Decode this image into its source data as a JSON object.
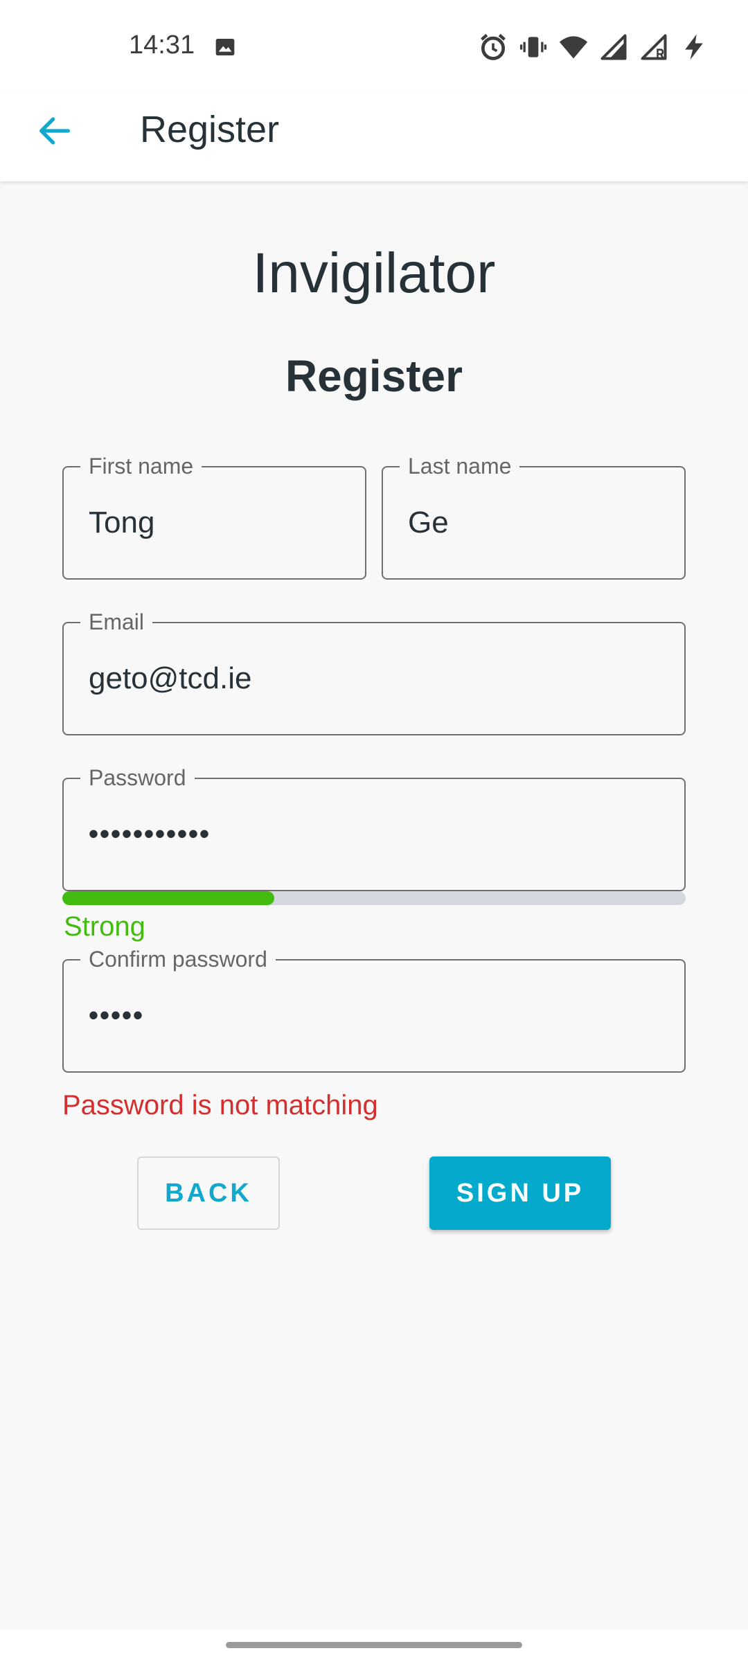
{
  "status_bar": {
    "time": "14:31",
    "icons": [
      "image-icon",
      "alarm-icon",
      "vibrate-icon",
      "wifi-icon",
      "signal-icon",
      "signal-roaming-icon",
      "charging-icon"
    ]
  },
  "app_bar": {
    "title": "Register",
    "back_icon": "arrow-left-icon"
  },
  "content": {
    "app_title": "Invigilator",
    "form_title": "Register"
  },
  "form": {
    "first_name": {
      "label": "First name",
      "value": "Tong"
    },
    "last_name": {
      "label": "Last name",
      "value": "Ge"
    },
    "email": {
      "label": "Email",
      "value": "geto@tcd.ie"
    },
    "password": {
      "label": "Password",
      "value": "•••••••••••"
    },
    "password_strength": {
      "label": "Strong",
      "level": 0.34
    },
    "confirm_password": {
      "label": "Confirm password",
      "value": "•••••"
    },
    "error": "Password is not matching"
  },
  "buttons": {
    "back": "BACK",
    "sign_up": "SIGN UP"
  },
  "colors": {
    "accent": "#04a9cc",
    "strength": "#44bb11",
    "error": "#d32f2f",
    "text": "#263238"
  }
}
